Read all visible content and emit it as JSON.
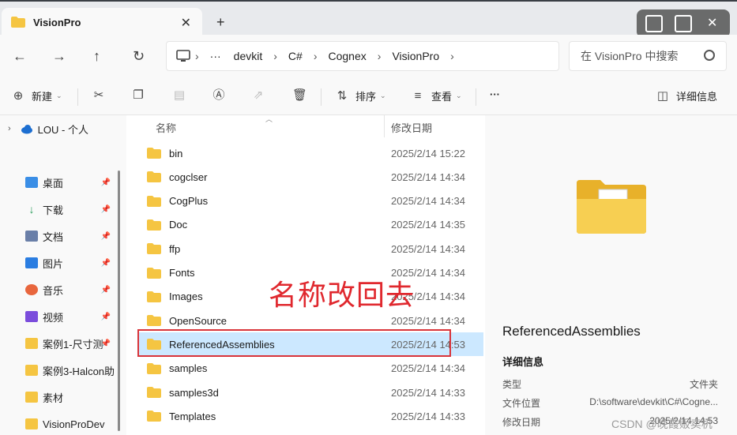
{
  "window": {
    "tab_title": "VisionPro",
    "tab_close": "✕",
    "new_tab": "+",
    "controls_close": "✕"
  },
  "nav": {
    "back": "←",
    "forward": "→",
    "up": "↑",
    "refresh": "↻",
    "breadcrumbs": [
      "devkit",
      "C#",
      "Cognex",
      "VisionPro"
    ],
    "ellipsis": "···",
    "search_placeholder": "在 VisionPro 中搜索"
  },
  "toolbar": {
    "new_label": "新建",
    "sort_label": "排序",
    "view_label": "查看",
    "more_label": "···",
    "details_label": "详细信息"
  },
  "sidebar": {
    "items": [
      {
        "label": "LOU - 个人",
        "icon": "cloud-icon",
        "pinned": false
      },
      {
        "label": "桌面",
        "icon": "desktop-icon",
        "pinned": true
      },
      {
        "label": "下载",
        "icon": "download-icon",
        "pinned": true
      },
      {
        "label": "文档",
        "icon": "document-icon",
        "pinned": true
      },
      {
        "label": "图片",
        "icon": "pictures-icon",
        "pinned": true
      },
      {
        "label": "音乐",
        "icon": "music-icon",
        "pinned": true
      },
      {
        "label": "视频",
        "icon": "video-icon",
        "pinned": true
      },
      {
        "label": "案例1-尺寸测",
        "icon": "folder-icon",
        "pinned": true
      },
      {
        "label": "案例3-Halcon助",
        "icon": "folder-icon",
        "pinned": false
      },
      {
        "label": "素材",
        "icon": "folder-icon",
        "pinned": false
      },
      {
        "label": "VisionProDev",
        "icon": "folder-icon",
        "pinned": false
      }
    ]
  },
  "files": {
    "col_name": "名称",
    "col_date": "修改日期",
    "rows": [
      {
        "name": "bin",
        "date": "2025/2/14 15:22"
      },
      {
        "name": "cogclser",
        "date": "2025/2/14 14:34"
      },
      {
        "name": "CogPlus",
        "date": "2025/2/14 14:34"
      },
      {
        "name": "Doc",
        "date": "2025/2/14 14:35"
      },
      {
        "name": "ffp",
        "date": "2025/2/14 14:34"
      },
      {
        "name": "Fonts",
        "date": "2025/2/14 14:34"
      },
      {
        "name": "Images",
        "date": "2025/2/14 14:34"
      },
      {
        "name": "OpenSource",
        "date": "2025/2/14 14:34"
      },
      {
        "name": "ReferencedAssemblies",
        "date": "2025/2/14 14:53"
      },
      {
        "name": "samples",
        "date": "2025/2/14 14:34"
      },
      {
        "name": "samples3d",
        "date": "2025/2/14 14:33"
      },
      {
        "name": "Templates",
        "date": "2025/2/14 14:33"
      }
    ],
    "selected_index": 8
  },
  "annotation": "名称改回去",
  "details": {
    "name": "ReferencedAssemblies",
    "section_title": "详细信息",
    "fields": [
      {
        "label": "类型",
        "value": "文件夹"
      },
      {
        "label": "文件位置",
        "value": "D:\\software\\devkit\\C#\\Cogne..."
      },
      {
        "label": "修改日期",
        "value": "2025/2/14 14:53"
      }
    ]
  },
  "watermark": "CSDN @晚霞贩卖机",
  "colors": {
    "folder_yellow": "#f5c542",
    "selection_blue": "#cce8ff",
    "annotation_red": "#e0282e"
  }
}
